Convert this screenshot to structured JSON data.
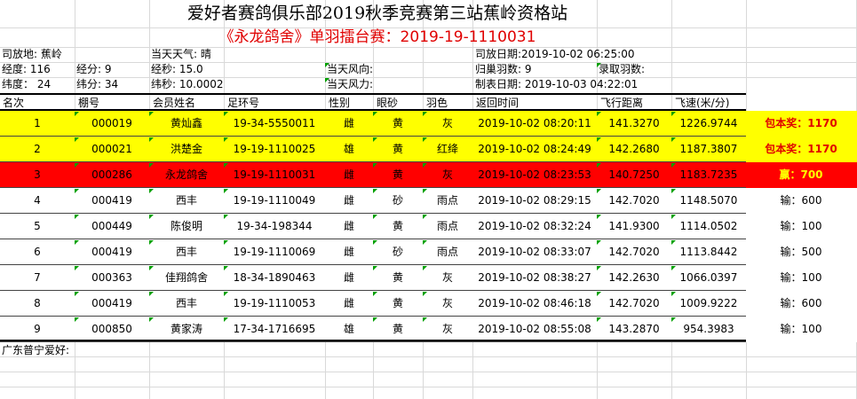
{
  "title": "爱好者赛鸽俱乐部2019秋季竞赛第三站蕉岭资格站",
  "subtitle": "《永龙鸽舍》单羽擂台赛：2019-19-1110031",
  "info": {
    "release_place": "司放地: 蕉岭",
    "weather": "当天天气: 晴",
    "release_date": "司放日期:2019-10-02 06:25:00",
    "longitude": "经度: 116",
    "lon_min": "经分: 9",
    "lon_sec": "经秒: 15.0",
    "wind_dir": "当天风向:",
    "returned": "归巢羽数: 9",
    "recorded": "录取羽数:",
    "latitude": "纬度：  24",
    "lat_min": "纬分: 34",
    "lat_sec": "纬秒: 10.0002",
    "wind_force": "当天风力:",
    "made_date": "制表日期: 2019-10-03 04:22:01"
  },
  "headers": [
    "名次",
    "棚号",
    "会员姓名",
    "足环号",
    "性别",
    "眼砂",
    "羽色",
    "返回时间",
    "飞行距离",
    "飞速(米/分)"
  ],
  "rows": [
    {
      "rank": "1",
      "shed": "000019",
      "name": "黄灿鑫",
      "ring": "19-34-5550011",
      "sex": "雌",
      "eye": "黄",
      "color": "灰",
      "time": "2019-10-02 08:20:11",
      "dist": "141.3270",
      "speed": "1226.9744",
      "prize": "包本奖：1170",
      "bg": "#ffff00",
      "prize_class": "prize"
    },
    {
      "rank": "2",
      "shed": "000021",
      "name": "洪楚金",
      "ring": "19-19-1110025",
      "sex": "雄",
      "eye": "黄",
      "color": "红绛",
      "time": "2019-10-02 08:24:49",
      "dist": "142.2680",
      "speed": "1187.3807",
      "prize": "包本奖：1170",
      "bg": "#ffff00",
      "prize_class": "prize"
    },
    {
      "rank": "3",
      "shed": "000286",
      "name": "永龙鸽舍",
      "ring": "19-19-1110031",
      "sex": "雌",
      "eye": "黄",
      "color": "灰",
      "time": "2019-10-02 08:23:53",
      "dist": "140.7250",
      "speed": "1183.7235",
      "prize": "赢：700",
      "bg": "#ff0000",
      "prize_class": "prize-red"
    },
    {
      "rank": "4",
      "shed": "000419",
      "name": "西丰",
      "ring": "19-19-1110049",
      "sex": "雌",
      "eye": "砂",
      "color": "雨点",
      "time": "2019-10-02 08:29:15",
      "dist": "142.7020",
      "speed": "1148.5070",
      "prize": "输：600",
      "bg": "#ffffff",
      "prize_class": ""
    },
    {
      "rank": "5",
      "shed": "000449",
      "name": "陈俊明",
      "ring": "19-34-198344",
      "sex": "雌",
      "eye": "黄",
      "color": "雨点",
      "time": "2019-10-02 08:32:24",
      "dist": "141.9300",
      "speed": "1114.0502",
      "prize": "输：100",
      "bg": "#ffffff",
      "prize_class": ""
    },
    {
      "rank": "6",
      "shed": "000419",
      "name": "西丰",
      "ring": "19-19-1110069",
      "sex": "雌",
      "eye": "砂",
      "color": "雨点",
      "time": "2019-10-02 08:33:07",
      "dist": "142.7020",
      "speed": "1113.8442",
      "prize": "输：500",
      "bg": "#ffffff",
      "prize_class": ""
    },
    {
      "rank": "7",
      "shed": "000363",
      "name": "佳翔鸽舍",
      "ring": "18-34-1890463",
      "sex": "雌",
      "eye": "黄",
      "color": "灰",
      "time": "2019-10-02 08:38:27",
      "dist": "142.2630",
      "speed": "1066.0397",
      "prize": "输：100",
      "bg": "#ffffff",
      "prize_class": ""
    },
    {
      "rank": "8",
      "shed": "000419",
      "name": "西丰",
      "ring": "19-19-1110053",
      "sex": "雌",
      "eye": "黄",
      "color": "灰",
      "time": "2019-10-02 08:46:18",
      "dist": "142.7020",
      "speed": "1009.9222",
      "prize": "输：600",
      "bg": "#ffffff",
      "prize_class": ""
    },
    {
      "rank": "9",
      "shed": "000850",
      "name": "黄家涛",
      "ring": "17-34-1716695",
      "sex": "雄",
      "eye": "黄",
      "color": "灰",
      "time": "2019-10-02 08:55:08",
      "dist": "143.2870",
      "speed": "954.3983",
      "prize": "输：100",
      "bg": "#ffffff",
      "prize_class": ""
    }
  ],
  "footer": "广东普宁爱好:"
}
